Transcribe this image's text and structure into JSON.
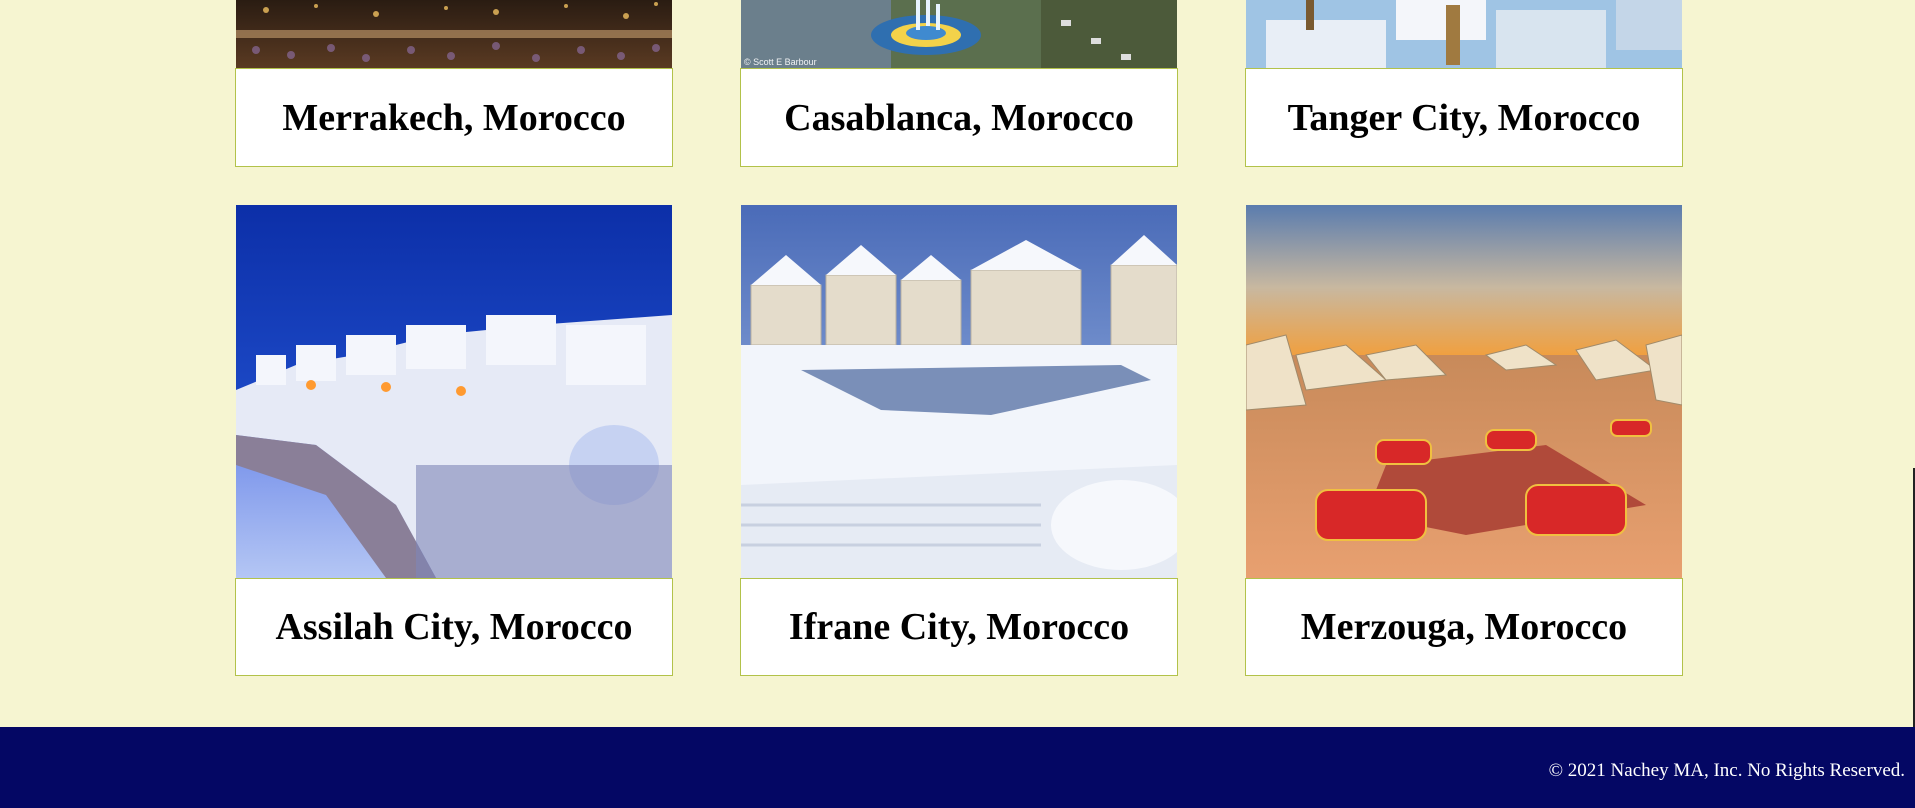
{
  "destinations": [
    {
      "name": "Merrakech, Morocco",
      "image": "Marrakech night market crowd"
    },
    {
      "name": "Casablanca, Morocco",
      "image": "Casablanca fountain square",
      "credit": "© Scott E Barbour"
    },
    {
      "name": "Tanger City, Morocco",
      "image": "Tangier white buildings"
    },
    {
      "name": "Assilah City, Morocco",
      "image": "Asilah seaside walls at dusk"
    },
    {
      "name": "Ifrane City, Morocco",
      "image": "Ifrane snow covered resort"
    },
    {
      "name": "Merzouga, Morocco",
      "image": "Merzouga desert camp at sunset"
    }
  ],
  "footer": {
    "copyright": "© 2021 Nachey MA, Inc. No Rights Reserved."
  },
  "colors": {
    "background": "#f6f5d1",
    "card_border": "#b2c24a",
    "footer": "#040764"
  }
}
